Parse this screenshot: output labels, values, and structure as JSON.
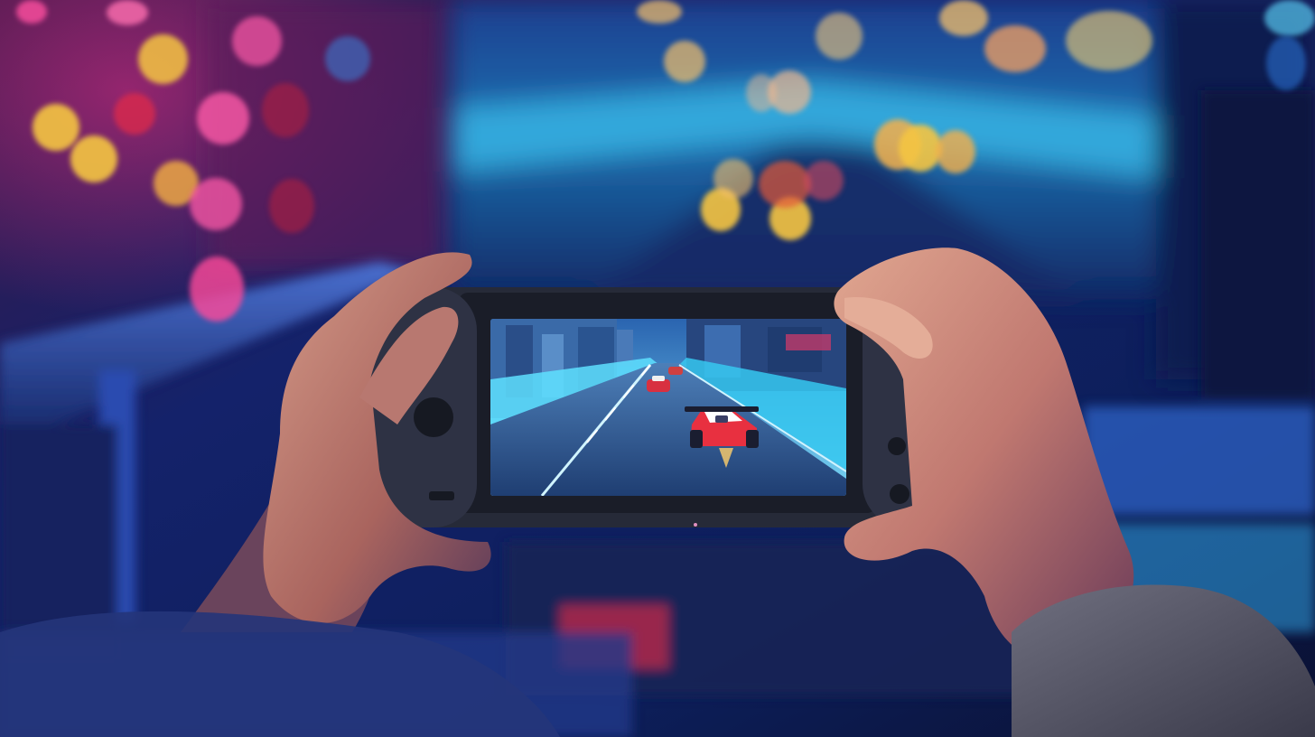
{
  "scene": {
    "description_tags": [
      "handheld-console",
      "racing-game",
      "neon-room"
    ],
    "colors": {
      "room_blue": "#1b3a8f",
      "neon_pink": "#e8378f",
      "warm_bokeh": "#f4c04a",
      "track_cyan": "#32c8f0",
      "console_body": "#2a2d3a",
      "skin": "#c98a78"
    }
  },
  "game_screen": {
    "race_cars_visible": 3
  }
}
